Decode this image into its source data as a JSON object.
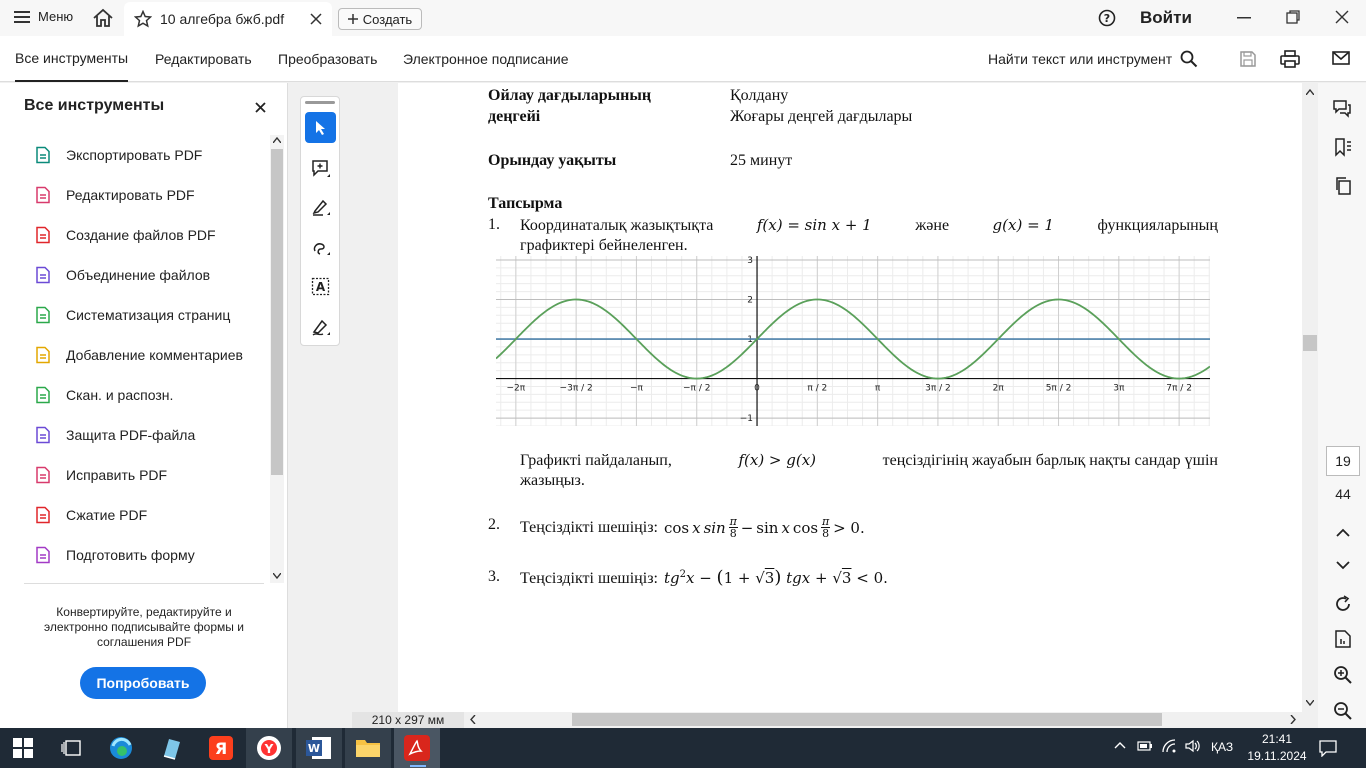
{
  "topbar": {
    "menu_label": "Меню",
    "tab_title": "10 алгебра бжб.pdf",
    "create_label": "Создать",
    "signin_label": "Войти"
  },
  "toolbar": {
    "tabs": [
      "Все инструменты",
      "Редактировать",
      "Преобразовать",
      "Электронное подписание"
    ],
    "search_label": "Найти текст или инструмент"
  },
  "left_panel": {
    "title": "Все инструменты",
    "items": [
      {
        "label": "Экспортировать PDF",
        "icon": "export-pdf-icon",
        "color": "#0a8a7a"
      },
      {
        "label": "Редактировать PDF",
        "icon": "edit-pdf-icon",
        "color": "#d83a6c"
      },
      {
        "label": "Создание файлов PDF",
        "icon": "create-pdf-icon",
        "color": "#e0262a"
      },
      {
        "label": "Объединение файлов",
        "icon": "combine-files-icon",
        "color": "#6b4ad6"
      },
      {
        "label": "Систематизация страниц",
        "icon": "organize-pages-icon",
        "color": "#2aa84a"
      },
      {
        "label": "Добавление комментариев",
        "icon": "comment-icon",
        "color": "#e3a700"
      },
      {
        "label": "Скан. и распозн.",
        "icon": "scan-icon",
        "color": "#2aa84a"
      },
      {
        "label": "Защита PDF-файла",
        "icon": "protect-icon",
        "color": "#6b4ad6"
      },
      {
        "label": "Исправить PDF",
        "icon": "redact-icon",
        "color": "#d83a6c"
      },
      {
        "label": "Сжатие PDF",
        "icon": "compress-icon",
        "color": "#e0262a"
      },
      {
        "label": "Подготовить форму",
        "icon": "prepare-form-icon",
        "color": "#a23ac6"
      }
    ],
    "promo_text": "Конвертируйте, редактируйте и электронно подписывайте формы и соглашения PDF",
    "try_button": "Попробовать"
  },
  "document": {
    "row1_label_a": "Ойлау дағдыларының",
    "row1_label_b": "деңгейі",
    "row1_value_a": "Қолдану",
    "row1_value_b": "Жоғары деңгей дағдылары",
    "row2_label": "Орындау уақыты",
    "row2_value": "25 минут",
    "task_heading": "Тапсырма",
    "q1_num": "1.",
    "q1_text_a": "Координаталық жазықтықта",
    "q1_f": "f(x) = sin x + 1",
    "q1_and": "және",
    "q1_g": "g(x) = 1",
    "q1_text_b": "функцияларының",
    "q1_text_c": "графиктері бейнеленген.",
    "q1_after_a": "Графикті пайдаланып,",
    "q1_ineq": "f(x) > g(x)",
    "q1_after_b": "теңсіздігінің жауабын барлық нақты сандар үшін",
    "q1_after_c": "жазыңыз.",
    "q2_num": "2.",
    "q2_text": "Теңсіздікті шешіңіз:",
    "q3_num": "3.",
    "q3_text": "Теңсіздікті шешіңіз:",
    "chart_data": {
      "type": "line",
      "x_ticks": [
        "−2π",
        "−3π / 2",
        "−π",
        "−π / 2",
        "0",
        "π / 2",
        "π",
        "3π / 2",
        "2π",
        "5π / 2",
        "3π",
        "7π / 2"
      ],
      "y_ticks": [
        "3",
        "2",
        "1",
        "−1"
      ],
      "xlim": [
        -6.8,
        11.8
      ],
      "ylim": [
        -1.2,
        3.1
      ],
      "series": [
        {
          "function": "sin(x)+1",
          "color": "#5aa05a"
        },
        {
          "function": "1",
          "color": "#4a7fa8"
        }
      ],
      "grid": true
    }
  },
  "right_rail": {
    "page_current": "19",
    "page_total": "44"
  },
  "statusbar": {
    "page_size": "210 x 297 мм"
  },
  "taskbar": {
    "lang": "ҚАЗ",
    "time": "21:41",
    "date": "19.11.2024"
  }
}
